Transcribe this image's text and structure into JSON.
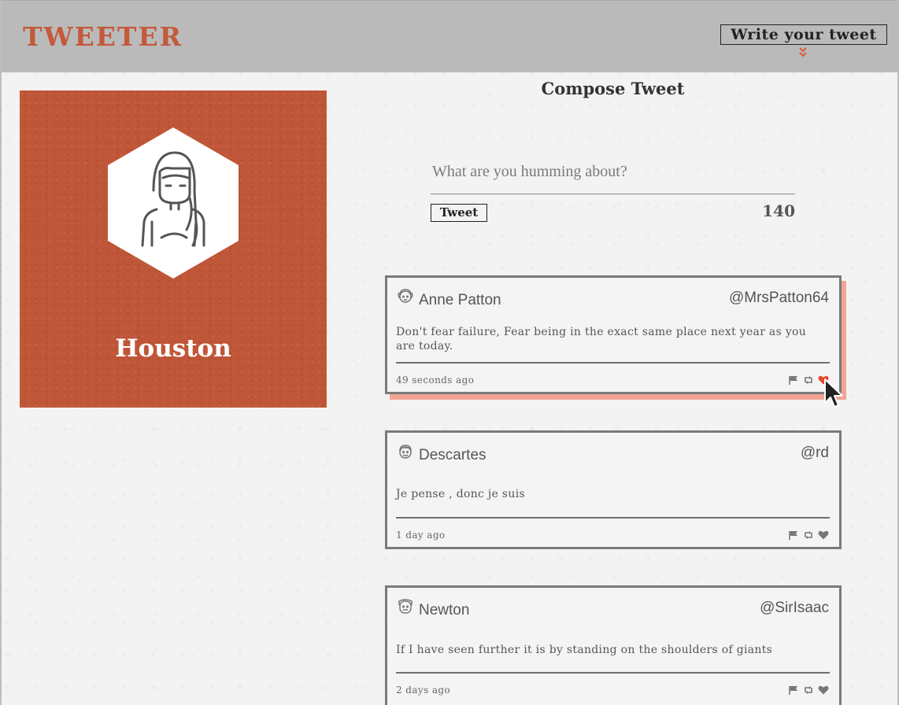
{
  "app": {
    "logo": "TWEETER",
    "write_button": "Write your tweet",
    "chevron_icon": "double-chevron-down-icon",
    "accent_color": "#c4593c"
  },
  "profile": {
    "name": "Houston",
    "avatar_icon": "girl-avatar-icon",
    "background_color": "#c05638"
  },
  "compose": {
    "title": "Compose Tweet",
    "placeholder": "What are you humming about?",
    "value": "",
    "button": "Tweet",
    "counter": "140"
  },
  "tweets": [
    {
      "name": "Anne Patton",
      "handle": "@MrsPatton64",
      "text": "Don't fear failure, Fear being in the exact same place next year as you are today.",
      "time": "49 seconds ago",
      "avatar_icon": "woman-avatar-icon",
      "liked": true,
      "actions": [
        "flag-icon",
        "retweet-icon",
        "heart-icon"
      ]
    },
    {
      "name": "Descartes",
      "handle": "@rd",
      "text": "Je pense , donc je suis",
      "time": "1 day ago",
      "avatar_icon": "man-avatar-icon",
      "liked": false,
      "actions": [
        "flag-icon",
        "retweet-icon",
        "heart-icon"
      ]
    },
    {
      "name": "Newton",
      "handle": "@SirIsaac",
      "text": "If I have seen further it is by standing on the shoulders of giants",
      "time": "2 days ago",
      "avatar_icon": "man-avatar-icon",
      "liked": false,
      "actions": [
        "flag-icon",
        "retweet-icon",
        "heart-icon"
      ]
    }
  ]
}
